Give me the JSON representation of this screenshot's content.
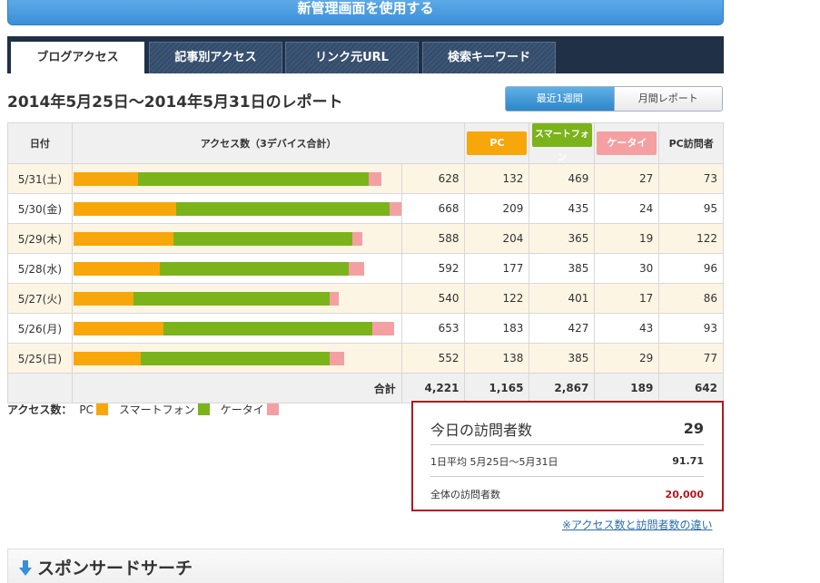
{
  "top_button": "新管理画面を使用する",
  "tabs": [
    "ブログアクセス",
    "記事別アクセス",
    "リンク元URL",
    "検索キーワード"
  ],
  "report_title": "2014年5月25日〜2014年5月31日のレポート",
  "period_toggle": {
    "week": "最近1週間",
    "month": "月間レポート"
  },
  "table": {
    "headers": {
      "date": "日付",
      "access": "アクセス数（3デバイス合計）",
      "pc": "PC",
      "smartphone": "スマートフォン",
      "keitai": "ケータイ",
      "pc_visitors": "PC訪問者"
    },
    "rows": [
      {
        "date": "5/31(土)",
        "total": "628",
        "pc": "132",
        "sp": "469",
        "kt": "27",
        "vis": "73"
      },
      {
        "date": "5/30(金)",
        "total": "668",
        "pc": "209",
        "sp": "435",
        "kt": "24",
        "vis": "95"
      },
      {
        "date": "5/29(木)",
        "total": "588",
        "pc": "204",
        "sp": "365",
        "kt": "19",
        "vis": "122"
      },
      {
        "date": "5/28(水)",
        "total": "592",
        "pc": "177",
        "sp": "385",
        "kt": "30",
        "vis": "96"
      },
      {
        "date": "5/27(火)",
        "total": "540",
        "pc": "122",
        "sp": "401",
        "kt": "17",
        "vis": "86"
      },
      {
        "date": "5/26(月)",
        "total": "653",
        "pc": "183",
        "sp": "427",
        "kt": "43",
        "vis": "93"
      },
      {
        "date": "5/25(日)",
        "total": "552",
        "pc": "138",
        "sp": "385",
        "kt": "29",
        "vis": "77"
      }
    ],
    "sum": {
      "label": "合計",
      "total": "4,221",
      "pc": "1,165",
      "sp": "2,867",
      "kt": "189",
      "vis": "642"
    }
  },
  "colors": {
    "pc": "#f7a70a",
    "smartphone": "#7bb31b",
    "keitai": "#f4a0a3"
  },
  "legend": {
    "title": "アクセス数：",
    "pc": "PC",
    "smartphone": "スマートフォン",
    "keitai": "ケータイ"
  },
  "today_box": {
    "label": "今日の訪問者数",
    "value": "29",
    "avg_label": "1日平均 5月25日〜5月31日",
    "avg_value": "91.71",
    "total_label": "全体の訪問者数",
    "total_value": "20,000"
  },
  "diff_link": "※アクセス数と訪問者数の違い",
  "sponsor_title": "スポンサードサーチ"
}
